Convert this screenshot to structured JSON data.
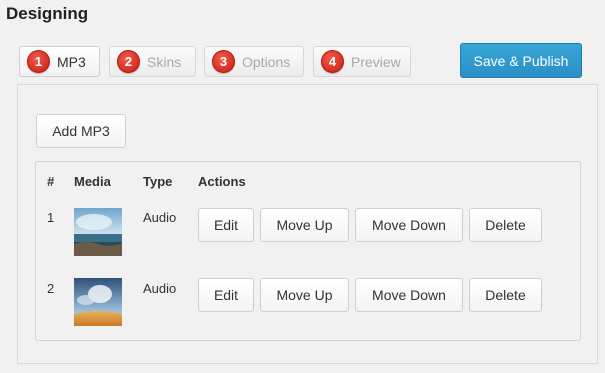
{
  "page": {
    "title": "Designing"
  },
  "tabs": [
    {
      "number": "1",
      "label": "MP3",
      "active": true
    },
    {
      "number": "2",
      "label": "Skins",
      "active": false
    },
    {
      "number": "3",
      "label": "Options",
      "active": false
    },
    {
      "number": "4",
      "label": "Preview",
      "active": false
    }
  ],
  "toolbar": {
    "publish_label": "Save & Publish"
  },
  "panel": {
    "add_label": "Add MP3"
  },
  "table": {
    "headers": {
      "index": "#",
      "media": "Media",
      "type": "Type",
      "actions": "Actions"
    },
    "rows": [
      {
        "index": "1",
        "type": "Audio",
        "edit": "Edit",
        "move_up": "Move Up",
        "move_down": "Move Down",
        "delete": "Delete"
      },
      {
        "index": "2",
        "type": "Audio",
        "edit": "Edit",
        "move_up": "Move Up",
        "move_down": "Move Down",
        "delete": "Delete"
      }
    ]
  },
  "colors": {
    "accent": "#2a8fc4",
    "badge": "#d9291c"
  }
}
